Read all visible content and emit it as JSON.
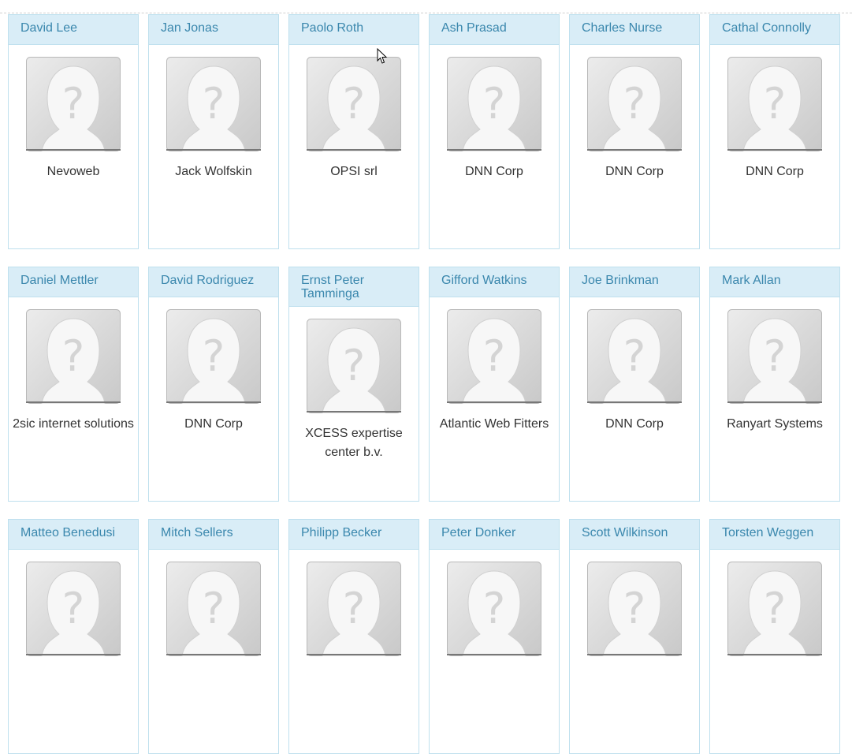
{
  "members": [
    {
      "name": "David Lee",
      "company": "Nevoweb"
    },
    {
      "name": "Jan Jonas",
      "company": "Jack Wolfskin"
    },
    {
      "name": "Paolo Roth",
      "company": "OPSI srl"
    },
    {
      "name": "Ash Prasad",
      "company": "DNN Corp"
    },
    {
      "name": "Charles Nurse",
      "company": "DNN Corp"
    },
    {
      "name": "Cathal Connolly",
      "company": "DNN Corp"
    },
    {
      "name": "Daniel Mettler",
      "company": "2sic internet solutions"
    },
    {
      "name": "David Rodriguez",
      "company": "DNN Corp"
    },
    {
      "name": "Ernst Peter Tamminga",
      "company": "XCESS expertise center b.v."
    },
    {
      "name": "Gifford Watkins",
      "company": "Atlantic Web Fitters"
    },
    {
      "name": "Joe Brinkman",
      "company": "DNN Corp"
    },
    {
      "name": "Mark Allan",
      "company": "Ranyart Systems"
    },
    {
      "name": "Matteo Benedusi",
      "company": ""
    },
    {
      "name": "Mitch Sellers",
      "company": ""
    },
    {
      "name": "Philipp Becker",
      "company": ""
    },
    {
      "name": "Peter Donker",
      "company": ""
    },
    {
      "name": "Scott Wilkinson",
      "company": ""
    },
    {
      "name": "Torsten Weggen",
      "company": ""
    }
  ],
  "icons": {
    "avatar": "unknown-user-avatar-icon",
    "cursor": "mouse-pointer-icon"
  },
  "colors": {
    "header_bg": "#d9edf7",
    "header_text": "#3a87ad",
    "border": "#bfe0ee"
  }
}
